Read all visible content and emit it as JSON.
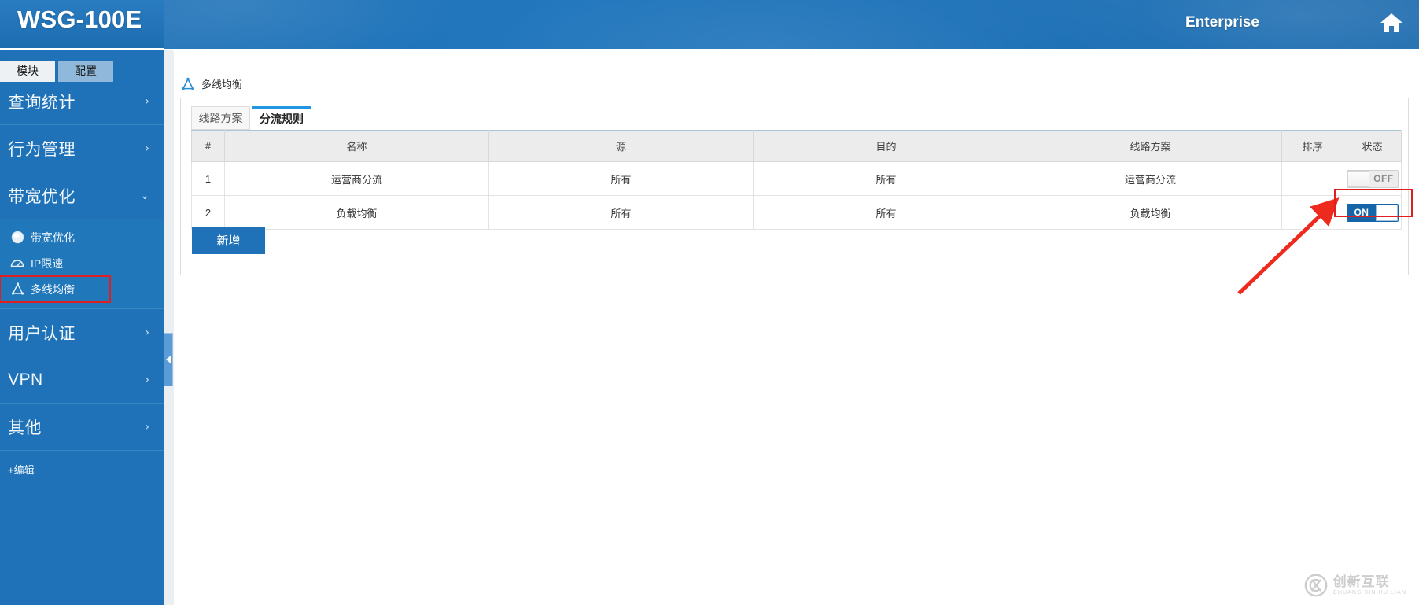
{
  "header": {
    "brand": "WSG-100E",
    "account": "Enterprise",
    "home_icon": "home-icon"
  },
  "sidebar": {
    "tabs": [
      {
        "label": "模块",
        "active": true
      },
      {
        "label": "配置",
        "active": false
      }
    ],
    "groups": [
      {
        "label": "查询统计",
        "arrow": "›",
        "expanded": false
      },
      {
        "label": "行为管理",
        "arrow": "›",
        "expanded": false
      },
      {
        "label": "带宽优化",
        "arrow": "⌄",
        "expanded": true
      },
      {
        "label": "用户认证",
        "arrow": "›",
        "expanded": false
      },
      {
        "label": "VPN",
        "arrow": "›",
        "expanded": false
      },
      {
        "label": "其他",
        "arrow": "›",
        "expanded": false
      }
    ],
    "sub_items": [
      {
        "label": "带宽优化",
        "icon": "sphere-icon",
        "highlighted": false
      },
      {
        "label": "IP限速",
        "icon": "gauge-icon",
        "highlighted": false
      },
      {
        "label": "多线均衡",
        "icon": "balance-icon",
        "highlighted": true
      }
    ],
    "edit_link": "+编辑",
    "collapse_handle": "chevron-left-icon"
  },
  "breadcrumb": {
    "icon": "balance-icon",
    "text": "多线均衡"
  },
  "tabs": [
    {
      "label": "线路方案",
      "active": false
    },
    {
      "label": "分流规则",
      "active": true
    }
  ],
  "table": {
    "headers": [
      "#",
      "名称",
      "源",
      "目的",
      "线路方案",
      "排序",
      "状态"
    ],
    "rows": [
      {
        "index": "1",
        "name": "运营商分流",
        "source": "所有",
        "destination": "所有",
        "plan": "运营商分流",
        "sort": "",
        "state": "OFF",
        "state_on": false,
        "highlighted": true
      },
      {
        "index": "2",
        "name": "负载均衡",
        "source": "所有",
        "destination": "所有",
        "plan": "负载均衡",
        "sort": "",
        "state": "ON",
        "state_on": true,
        "highlighted": false
      }
    ]
  },
  "actions": {
    "add_label": "新增"
  },
  "watermark": {
    "main": "创新互联",
    "sub": "CHUANG XIN HU LIAN"
  },
  "colors": {
    "brand_blue": "#1f72b8",
    "accent_blue": "#2196e3",
    "toggle_on": "#1565a8",
    "highlight_red": "#e02020"
  }
}
